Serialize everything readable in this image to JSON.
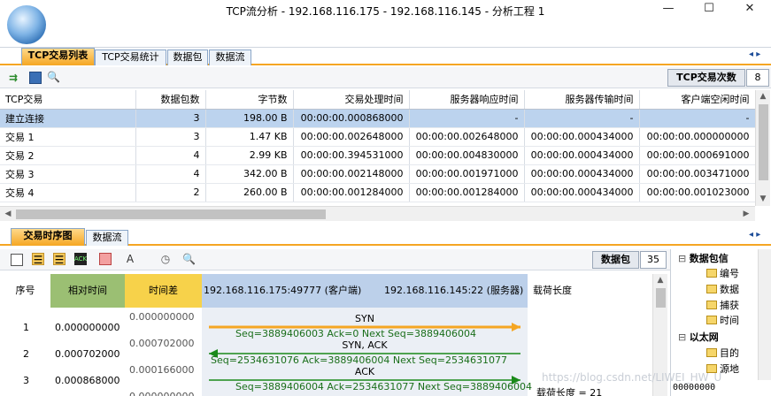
{
  "window": {
    "title": "TCP流分析 - 192.168.116.175 - 192.168.116.145 - 分析工程 1",
    "controls": [
      "—",
      "☐",
      "✕"
    ]
  },
  "top_tabs": [
    "TCP交易列表",
    "TCP交易统计",
    "数据包",
    "数据流"
  ],
  "top_nav_arrows": "◂ ▸",
  "counter": {
    "label": "TCP交易次数",
    "value": "8"
  },
  "transactions": {
    "columns": [
      "TCP交易",
      "数据包数",
      "字节数",
      "交易处理时间",
      "服务器响应时间",
      "服务器传输时间",
      "客户端空闲时间"
    ],
    "rows": [
      [
        "建立连接",
        "3",
        "198.00 B",
        "00:00:00.000868000",
        "-",
        "-",
        "-"
      ],
      [
        "交易 1",
        "3",
        "1.47 KB",
        "00:00:00.002648000",
        "00:00:00.002648000",
        "00:00:00.000434000",
        "00:00:00.000000000"
      ],
      [
        "交易 2",
        "4",
        "2.99 KB",
        "00:00:00.394531000",
        "00:00:00.004830000",
        "00:00:00.000434000",
        "00:00:00.000691000"
      ],
      [
        "交易 3",
        "4",
        "342.00 B",
        "00:00:00.002148000",
        "00:00:00.001971000",
        "00:00:00.000434000",
        "00:00:00.003471000"
      ],
      [
        "交易 4",
        "2",
        "260.00 B",
        "00:00:00.001284000",
        "00:00:00.001284000",
        "00:00:00.000434000",
        "00:00:00.001023000"
      ]
    ]
  },
  "bottom_tabs": [
    "交易时序图",
    "数据流"
  ],
  "packets_counter": {
    "label": "数据包",
    "value": "35"
  },
  "sequence": {
    "columns": [
      "序号",
      "相对时间",
      "时间差",
      "192.168.116.175:49777 (客户端)",
      "192.168.116.145:22 (服务器)",
      "载荷长度"
    ],
    "rows": [
      {
        "no": "1",
        "rel": "0.000000000",
        "diff": "0.000000000"
      },
      {
        "no": "2",
        "rel": "0.000702000",
        "diff": "0.000702000"
      },
      {
        "no": "3",
        "rel": "0.000868000",
        "diff": "0.000166000"
      }
    ],
    "next_diff": "0.000000000",
    "flows": [
      {
        "name": "SYN",
        "detail": "Seq=3889406003  Ack=0  Next Seq=3889406004",
        "dir": "right",
        "color": "#f5a623"
      },
      {
        "name": "SYN, ACK",
        "detail": "Seq=2534631076  Ack=3889406004  Next Seq=2534631077",
        "dir": "left",
        "color": "#1a8a1a"
      },
      {
        "name": "ACK",
        "detail": "Seq=3889406004  Ack=2534631077  Next Seq=3889406004",
        "dir": "right",
        "color": "#1a8a1a"
      }
    ],
    "payload_note": "载荷长度 = 21"
  },
  "tree": {
    "nodes": [
      {
        "label": "数据包信",
        "kind": "group"
      },
      {
        "label": "编号",
        "kind": "leaf"
      },
      {
        "label": "数据",
        "kind": "leaf"
      },
      {
        "label": "捕获",
        "kind": "leaf"
      },
      {
        "label": "时间",
        "kind": "leaf"
      },
      {
        "label": "以太网",
        "kind": "group"
      },
      {
        "label": "目的",
        "kind": "leaf"
      },
      {
        "label": "源地",
        "kind": "leaf"
      }
    ],
    "hex_preview": "00000000"
  },
  "watermark": "https://blog.csdn.net/LIWEI_HW_U",
  "icons": {
    "export": "arrows-export-icon",
    "save": "save-icon",
    "search": "search-icon"
  }
}
